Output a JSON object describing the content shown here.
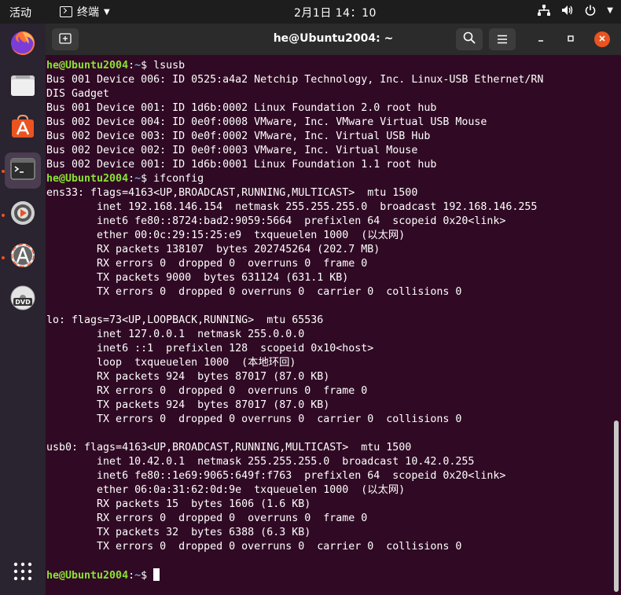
{
  "topbar": {
    "activities": "活动",
    "app_name": "终端",
    "clock": "2月1日  14：10"
  },
  "window": {
    "title": "he@Ubuntu2004: ~"
  },
  "prompt": {
    "user_host": "he@Ubuntu2004",
    "sep": ":",
    "path": "~",
    "dollar": "$ "
  },
  "terminal_lines": [
    {
      "type": "cmd",
      "text": "lsusb"
    },
    {
      "type": "out",
      "text": "Bus 001 Device 006: ID 0525:a4a2 Netchip Technology, Inc. Linux-USB Ethernet/RN"
    },
    {
      "type": "out",
      "text": "DIS Gadget"
    },
    {
      "type": "out",
      "text": "Bus 001 Device 001: ID 1d6b:0002 Linux Foundation 2.0 root hub"
    },
    {
      "type": "out",
      "text": "Bus 002 Device 004: ID 0e0f:0008 VMware, Inc. VMware Virtual USB Mouse"
    },
    {
      "type": "out",
      "text": "Bus 002 Device 003: ID 0e0f:0002 VMware, Inc. Virtual USB Hub"
    },
    {
      "type": "out",
      "text": "Bus 002 Device 002: ID 0e0f:0003 VMware, Inc. Virtual Mouse"
    },
    {
      "type": "out",
      "text": "Bus 002 Device 001: ID 1d6b:0001 Linux Foundation 1.1 root hub"
    },
    {
      "type": "cmd",
      "text": "ifconfig"
    },
    {
      "type": "out",
      "text": "ens33: flags=4163<UP,BROADCAST,RUNNING,MULTICAST>  mtu 1500"
    },
    {
      "type": "out",
      "text": "        inet 192.168.146.154  netmask 255.255.255.0  broadcast 192.168.146.255"
    },
    {
      "type": "out",
      "text": "        inet6 fe80::8724:bad2:9059:5664  prefixlen 64  scopeid 0x20<link>"
    },
    {
      "type": "out",
      "text": "        ether 00:0c:29:15:25:e9  txqueuelen 1000  (以太网)"
    },
    {
      "type": "out",
      "text": "        RX packets 138107  bytes 202745264 (202.7 MB)"
    },
    {
      "type": "out",
      "text": "        RX errors 0  dropped 0  overruns 0  frame 0"
    },
    {
      "type": "out",
      "text": "        TX packets 9000  bytes 631124 (631.1 KB)"
    },
    {
      "type": "out",
      "text": "        TX errors 0  dropped 0 overruns 0  carrier 0  collisions 0"
    },
    {
      "type": "out",
      "text": ""
    },
    {
      "type": "out",
      "text": "lo: flags=73<UP,LOOPBACK,RUNNING>  mtu 65536"
    },
    {
      "type": "out",
      "text": "        inet 127.0.0.1  netmask 255.0.0.0"
    },
    {
      "type": "out",
      "text": "        inet6 ::1  prefixlen 128  scopeid 0x10<host>"
    },
    {
      "type": "out",
      "text": "        loop  txqueuelen 1000  (本地环回)"
    },
    {
      "type": "out",
      "text": "        RX packets 924  bytes 87017 (87.0 KB)"
    },
    {
      "type": "out",
      "text": "        RX errors 0  dropped 0  overruns 0  frame 0"
    },
    {
      "type": "out",
      "text": "        TX packets 924  bytes 87017 (87.0 KB)"
    },
    {
      "type": "out",
      "text": "        TX errors 0  dropped 0 overruns 0  carrier 0  collisions 0"
    },
    {
      "type": "out",
      "text": ""
    },
    {
      "type": "out",
      "text": "usb0: flags=4163<UP,BROADCAST,RUNNING,MULTICAST>  mtu 1500"
    },
    {
      "type": "out",
      "text": "        inet 10.42.0.1  netmask 255.255.255.0  broadcast 10.42.0.255"
    },
    {
      "type": "out",
      "text": "        inet6 fe80::1e69:9065:649f:f763  prefixlen 64  scopeid 0x20<link>"
    },
    {
      "type": "out",
      "text": "        ether 06:0a:31:62:0d:9e  txqueuelen 1000  (以太网)"
    },
    {
      "type": "out",
      "text": "        RX packets 15  bytes 1606 (1.6 KB)"
    },
    {
      "type": "out",
      "text": "        RX errors 0  dropped 0  overruns 0  frame 0"
    },
    {
      "type": "out",
      "text": "        TX packets 32  bytes 6388 (6.3 KB)"
    },
    {
      "type": "out",
      "text": "        TX errors 0  dropped 0 overruns 0  carrier 0  collisions 0"
    },
    {
      "type": "out",
      "text": ""
    },
    {
      "type": "cmd",
      "text": ""
    }
  ],
  "colors": {
    "terminal_bg": "#300a24",
    "prompt_user": "#8ae234",
    "prompt_path": "#729fcf",
    "accent": "#e95420"
  },
  "dock": {
    "items": [
      "firefox-icon",
      "files-icon",
      "software-center-icon",
      "terminal-icon",
      "rhythmbox-icon",
      "software-updater-icon",
      "dvd-icon",
      "app-grid-icon"
    ]
  }
}
